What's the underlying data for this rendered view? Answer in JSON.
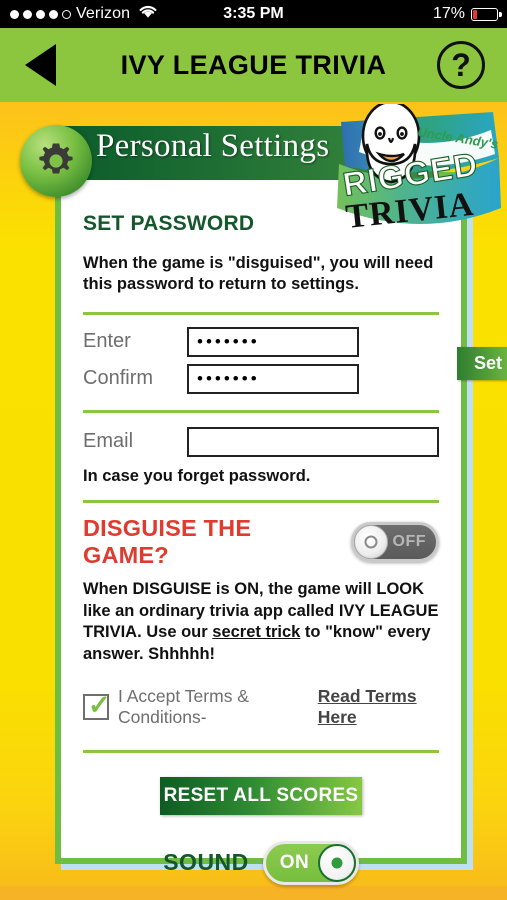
{
  "statusbar": {
    "carrier": "Verizon",
    "signal_dots_filled": 4,
    "signal_dots_total": 5,
    "wifi_icon": "wifi-icon",
    "time": "3:35 PM",
    "battery_percent": "17%",
    "battery_level": 17,
    "battery_color": "#e8372c"
  },
  "navbar": {
    "back_icon": "back-triangle-icon",
    "title": "IVY LEAGUE TRIVIA",
    "help_label": "?",
    "bar_color": "#8CC63F"
  },
  "panel": {
    "gear_icon": "gear-icon",
    "title": "Personal Settings"
  },
  "logo": {
    "brand_top": "Uncle Andy's",
    "brand_mid": "RIGGED",
    "brand_bottom": "TRIVIA",
    "face_icon": "uncle-andy-face-icon"
  },
  "password": {
    "section_title": "SET PASSWORD",
    "note": "When the game is \"disguised\", you will need this password to return to settings.",
    "enter_label": "Enter",
    "enter_value": "•••••••",
    "enter_placeholder": "",
    "confirm_label": "Confirm",
    "confirm_value": "•••••••",
    "confirm_placeholder": "",
    "set_button": "Set"
  },
  "email": {
    "label": "Email",
    "value": "",
    "placeholder": "",
    "hint": "In case you forget password."
  },
  "disguise": {
    "title": "DISGUISE THE GAME?",
    "title_color": "#E03B2F",
    "toggle_state": "OFF",
    "toggle_label": "OFF",
    "body_part1": "When DISGUISE is ON, the game will LOOK like an ordinary trivia app called IVY LEAGUE TRIVIA. Use our ",
    "body_link": "secret trick",
    "body_part2": " to \"know\" every answer. Shhhhh!"
  },
  "terms": {
    "checked": true,
    "check_glyph": "✓",
    "label": "I Accept Terms & Conditions-",
    "link": "Read Terms Here"
  },
  "actions": {
    "reset_button": "RESET ALL SCORES",
    "sound_label": "SOUND",
    "sound_toggle_state": "ON",
    "sound_toggle_label": "ON"
  },
  "theme": {
    "green_accent": "#8CC63F",
    "dark_green": "#14572A",
    "background_yellow": "#FAE000",
    "card_shadow_blue": "#BFE0F2",
    "bottom_bar": "#F7B326"
  }
}
